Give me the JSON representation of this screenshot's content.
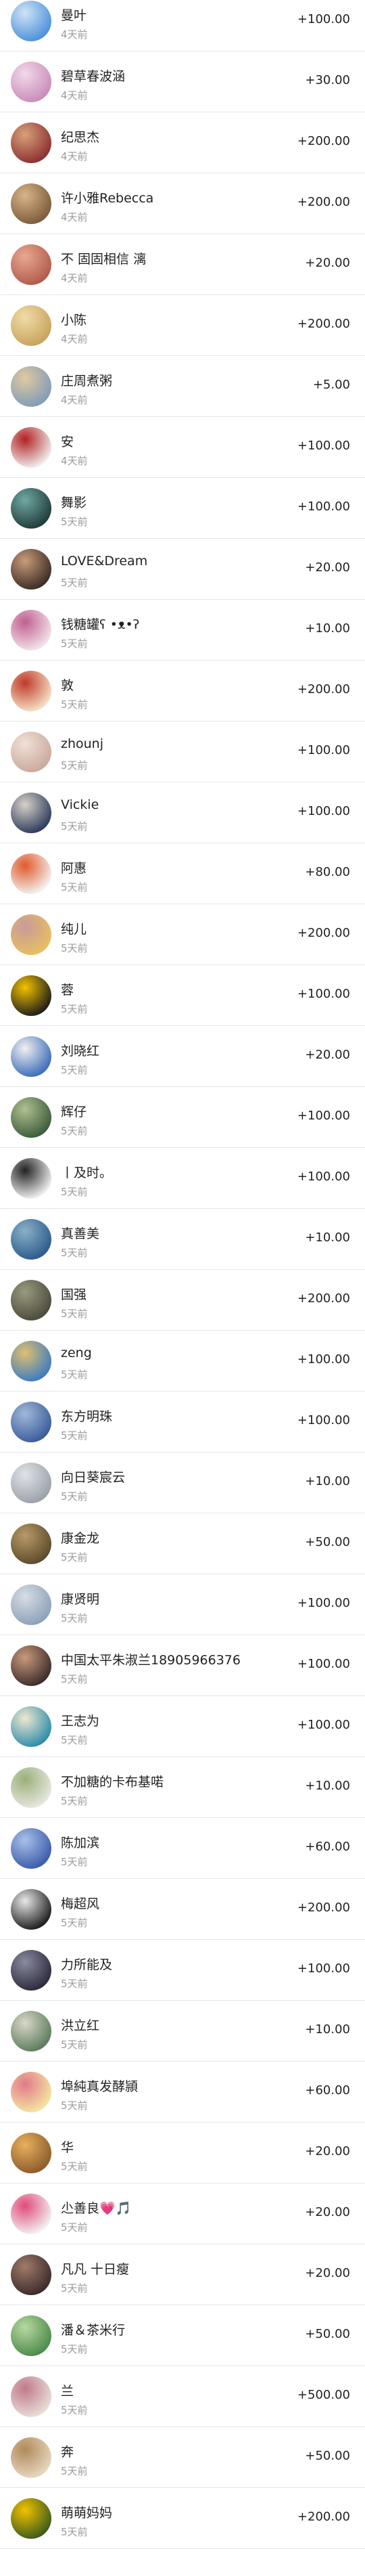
{
  "rewards": [
    {
      "name": "曼叶",
      "time": "4天前",
      "amount": "+100.00",
      "avatar_icon": "sky-photo-icon",
      "avatar_colors": [
        "#4a90d9",
        "#cfe3f5"
      ]
    },
    {
      "name": "碧草春波涵",
      "time": "4天前",
      "amount": "+30.00",
      "avatar_icon": "flower-photo-icon",
      "avatar_colors": [
        "#c98bb9",
        "#f1d9e9"
      ]
    },
    {
      "name": "纪思杰",
      "time": "4天前",
      "amount": "+200.00",
      "avatar_icon": "building-photo-icon",
      "avatar_colors": [
        "#8a2f2f",
        "#d8a07a"
      ]
    },
    {
      "name": "许小雅Rebecca",
      "time": "4天前",
      "amount": "+200.00",
      "avatar_icon": "person-photo-icon",
      "avatar_colors": [
        "#7a5a3a",
        "#d9b48a"
      ]
    },
    {
      "name": "不 固固相信 漓",
      "time": "4天前",
      "amount": "+20.00",
      "avatar_icon": "person-photo-icon",
      "avatar_colors": [
        "#b05a4a",
        "#e8a890"
      ]
    },
    {
      "name": "小陈",
      "time": "4天前",
      "amount": "+200.00",
      "avatar_icon": "person-photo-icon",
      "avatar_colors": [
        "#c8a25a",
        "#f0dca8"
      ]
    },
    {
      "name": "庄周煮粥",
      "time": "4天前",
      "amount": "+5.00",
      "avatar_icon": "sky-photo-icon",
      "avatar_colors": [
        "#7f9bb8",
        "#e0c9a0"
      ]
    },
    {
      "name": "安",
      "time": "4天前",
      "amount": "+100.00",
      "avatar_icon": "calligraphy-icon",
      "avatar_colors": [
        "#f2f2f2",
        "#b22222"
      ]
    },
    {
      "name": "舞影",
      "time": "5天前",
      "amount": "+100.00",
      "avatar_icon": "landscape-photo-icon",
      "avatar_colors": [
        "#1f3a3a",
        "#6fa8a0"
      ]
    },
    {
      "name": "LOVE&Dream",
      "time": "5天前",
      "amount": "+20.00",
      "avatar_icon": "person-photo-icon",
      "avatar_colors": [
        "#3a2a22",
        "#c79b7a"
      ]
    },
    {
      "name": "钱糖罐ʕ •ᴥ•ʔ",
      "time": "5天前",
      "amount": "+10.00",
      "avatar_icon": "flower-photo-icon",
      "avatar_colors": [
        "#f4e6ec",
        "#c06090"
      ]
    },
    {
      "name": "敦",
      "time": "5天前",
      "amount": "+200.00",
      "avatar_icon": "cartoon-icon",
      "avatar_colors": [
        "#f7e4c8",
        "#c0392b"
      ]
    },
    {
      "name": "zhounj",
      "time": "5天前",
      "amount": "+100.00",
      "avatar_icon": "person-photo-icon",
      "avatar_colors": [
        "#caa89a",
        "#f0e0d8"
      ]
    },
    {
      "name": "Vickie",
      "time": "5天前",
      "amount": "+100.00",
      "avatar_icon": "person-photo-icon",
      "avatar_colors": [
        "#2a3a5a",
        "#d8d0c8"
      ]
    },
    {
      "name": "阿惠",
      "time": "5天前",
      "amount": "+80.00",
      "avatar_icon": "flower-photo-icon",
      "avatar_colors": [
        "#f5f5f5",
        "#e05a2a"
      ]
    },
    {
      "name": "纯儿",
      "time": "5天前",
      "amount": "+200.00",
      "avatar_icon": "person-photo-icon",
      "avatar_colors": [
        "#e8c060",
        "#c89a9a"
      ]
    },
    {
      "name": "蓉",
      "time": "5天前",
      "amount": "+100.00",
      "avatar_icon": "flower-photo-icon",
      "avatar_colors": [
        "#1a1a1a",
        "#f2c200"
      ]
    },
    {
      "name": "刘晓红",
      "time": "5天前",
      "amount": "+20.00",
      "avatar_icon": "mountain-photo-icon",
      "avatar_colors": [
        "#3a6ab8",
        "#f0f0f0"
      ]
    },
    {
      "name": "辉仔",
      "time": "5天前",
      "amount": "+100.00",
      "avatar_icon": "person-photo-icon",
      "avatar_colors": [
        "#3a5a3a",
        "#b0c090"
      ]
    },
    {
      "name": "丨及时。",
      "time": "5天前",
      "amount": "+100.00",
      "avatar_icon": "pagoda-icon",
      "avatar_colors": [
        "#f5f5f5",
        "#222222"
      ]
    },
    {
      "name": "真善美",
      "time": "5天前",
      "amount": "+10.00",
      "avatar_icon": "building-photo-icon",
      "avatar_colors": [
        "#2a5a8a",
        "#8ab0c8"
      ]
    },
    {
      "name": "国强",
      "time": "5天前",
      "amount": "+200.00",
      "avatar_icon": "person-photo-icon",
      "avatar_colors": [
        "#4a4a3a",
        "#9a9a80"
      ]
    },
    {
      "name": "zeng",
      "time": "5天前",
      "amount": "+100.00",
      "avatar_icon": "landscape-photo-icon",
      "avatar_colors": [
        "#3a7ac0",
        "#e0c070"
      ]
    },
    {
      "name": "东方明珠",
      "time": "5天前",
      "amount": "+100.00",
      "avatar_icon": "building-photo-icon",
      "avatar_colors": [
        "#3a5a9a",
        "#a0b8d8"
      ]
    },
    {
      "name": "向日葵宸云",
      "time": "5天前",
      "amount": "+10.00",
      "avatar_icon": "building-photo-icon",
      "avatar_colors": [
        "#9aa0a8",
        "#dfe3e8"
      ]
    },
    {
      "name": "康金龙",
      "time": "5天前",
      "amount": "+50.00",
      "avatar_icon": "person-photo-icon",
      "avatar_colors": [
        "#5a4a2a",
        "#b89a6a"
      ]
    },
    {
      "name": "康贤明",
      "time": "5天前",
      "amount": "+100.00",
      "avatar_icon": "person-photo-icon",
      "avatar_colors": [
        "#8aa0b8",
        "#d8dde3"
      ]
    },
    {
      "name": "中国太平朱淑兰18905966376",
      "time": "5天前",
      "amount": "+100.00",
      "avatar_icon": "person-photo-icon",
      "avatar_colors": [
        "#3a2a2a",
        "#c89a7a"
      ]
    },
    {
      "name": "王志为",
      "time": "5天前",
      "amount": "+100.00",
      "avatar_icon": "landscape-photo-icon",
      "avatar_colors": [
        "#2a8aa8",
        "#f0e8d0"
      ]
    },
    {
      "name": "不加糖的卡布基喏",
      "time": "5天前",
      "amount": "+10.00",
      "avatar_icon": "flower-photo-icon",
      "avatar_colors": [
        "#e8e8e0",
        "#9ab07a"
      ]
    },
    {
      "name": "陈加滨",
      "time": "5天前",
      "amount": "+60.00",
      "avatar_icon": "sky-photo-icon",
      "avatar_colors": [
        "#3a5aa8",
        "#a8c0e8"
      ]
    },
    {
      "name": "梅超风",
      "time": "5天前",
      "amount": "+200.00",
      "avatar_icon": "car-photo-icon",
      "avatar_colors": [
        "#1a1a1a",
        "#e8e8e8"
      ]
    },
    {
      "name": "力所能及",
      "time": "5天前",
      "amount": "+100.00",
      "avatar_icon": "car-photo-icon",
      "avatar_colors": [
        "#2a2a3a",
        "#8a8aa0"
      ]
    },
    {
      "name": "洪立红",
      "time": "5天前",
      "amount": "+10.00",
      "avatar_icon": "landscape-photo-icon",
      "avatar_colors": [
        "#5a7a5a",
        "#d8d8c8"
      ]
    },
    {
      "name": "埠純真发酵頴",
      "time": "5天前",
      "amount": "+60.00",
      "avatar_icon": "flower-photo-icon",
      "avatar_colors": [
        "#f5e8a0",
        "#e07a8a"
      ]
    },
    {
      "name": "华",
      "time": "5天前",
      "amount": "+20.00",
      "avatar_icon": "flower-photo-icon",
      "avatar_colors": [
        "#8a5a2a",
        "#e8b060"
      ]
    },
    {
      "name": "尐善良💗🎵",
      "time": "5天前",
      "amount": "+20.00",
      "avatar_icon": "person-photo-icon",
      "avatar_colors": [
        "#f5f5f5",
        "#e04a7a"
      ]
    },
    {
      "name": "凡凡 十日瘦",
      "time": "5天前",
      "amount": "+20.00",
      "avatar_icon": "person-photo-icon",
      "avatar_colors": [
        "#3a2a2a",
        "#a07a6a"
      ]
    },
    {
      "name": "潘＆茶米行",
      "time": "5天前",
      "amount": "+50.00",
      "avatar_icon": "leaf-photo-icon",
      "avatar_colors": [
        "#4a8a4a",
        "#b8d8a0"
      ]
    },
    {
      "name": "兰",
      "time": "5天前",
      "amount": "+500.00",
      "avatar_icon": "flower-photo-icon",
      "avatar_colors": [
        "#e8e0d8",
        "#c07a8a"
      ]
    },
    {
      "name": "奔",
      "time": "5天前",
      "amount": "+50.00",
      "avatar_icon": "dog-photo-icon",
      "avatar_colors": [
        "#e8d8c0",
        "#b08a5a"
      ]
    },
    {
      "name": "萌萌妈妈",
      "time": "5天前",
      "amount": "+200.00",
      "avatar_icon": "flower-photo-icon",
      "avatar_colors": [
        "#3a5a1a",
        "#f2c200"
      ]
    }
  ]
}
